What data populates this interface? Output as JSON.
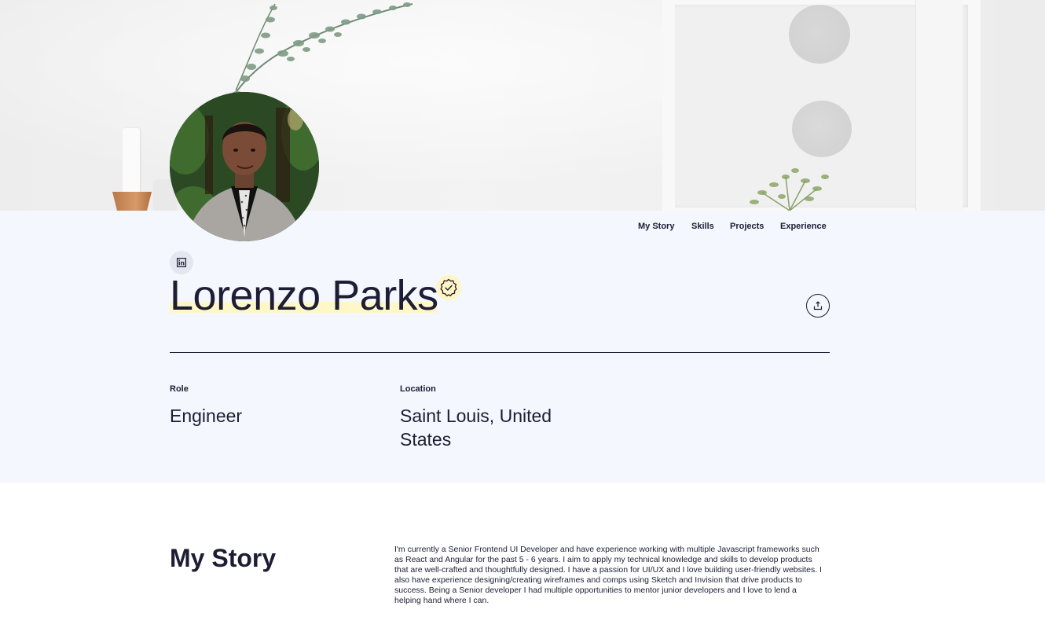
{
  "profile": {
    "name": "Lorenzo Parks",
    "role_label": "Role",
    "role_value": "Engineer",
    "location_label": "Location",
    "location_value_line1": "Saint Louis, United",
    "location_value_line2": "States"
  },
  "nav": {
    "items": [
      {
        "label": "My Story"
      },
      {
        "label": "Skills"
      },
      {
        "label": "Projects"
      },
      {
        "label": "Experience"
      }
    ]
  },
  "story": {
    "title": "My Story",
    "lines": [
      "I'm currently a Senior Frontend UI Developer and have experience working with multiple Javascript frameworks such",
      "as React and Angular for the past 5 - 6 years. I aim to apply my technical knowledge and skills to develop products",
      "that are well-crafted and thoughtfully designed. I have a passion for UI/UX and I love building user-friendly websites. I",
      "also have experience designing/creating wireframes and comps using Sketch and Invision that drive products to",
      "success. Being a Senior developer I had multiple opportunities to mentor junior developers and I love to lend a",
      "helping hand where I can."
    ]
  },
  "icons": {
    "linkedin": "linkedin-icon",
    "verified": "verified-badge-icon",
    "share": "share-icon"
  },
  "colors": {
    "text": "#1d1d34",
    "band_background": "#f4f7fd",
    "highlight": "#fff7c7"
  }
}
